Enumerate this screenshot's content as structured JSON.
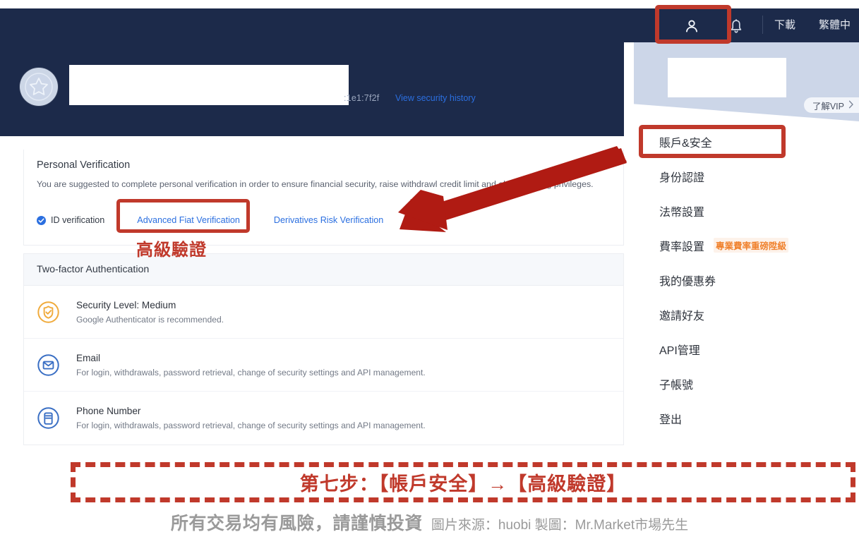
{
  "account_header": {
    "avatar_icon": "star-badge-icon",
    "name_redacted": "",
    "ip_fragment": ":1e1:7f2f",
    "security_history_link": "View security history"
  },
  "personal_verification": {
    "title": "Personal Verification",
    "description": "You are suggested to complete personal verification in order to ensure financial security, raise withdrawl credit limit and obtain trading privileges.",
    "id_verification_label": "ID verification",
    "advanced_fiat_label": "Advanced Fiat Verification",
    "derivatives_risk_label": "Derivatives Risk Verification"
  },
  "two_factor": {
    "header": "Two-factor Authentication",
    "rows": [
      {
        "icon": "shield-check-icon",
        "title": "Security Level: Medium",
        "desc": "Google Authenticator is recommended."
      },
      {
        "icon": "envelope-icon",
        "title": "Email",
        "desc": "For login, withdrawals, password retrieval, change of security settings and API management."
      },
      {
        "icon": "phone-icon",
        "title": "Phone Number",
        "desc": "For login, withdrawals, password retrieval, change of security settings and API management."
      }
    ]
  },
  "right_panel": {
    "topnav": {
      "person_icon": "person-icon",
      "bell_icon": "bell-icon",
      "download_label": "下載",
      "language_label": "繁體中"
    },
    "vip_banner": {
      "learn_vip_label": "了解VIP",
      "chevron_icon": "chevron-right-icon"
    },
    "menu_items": [
      {
        "label": "賬戶&安全",
        "badge": ""
      },
      {
        "label": "身份認證",
        "badge": ""
      },
      {
        "label": "法幣設置",
        "badge": ""
      },
      {
        "label": "費率設置",
        "badge": "專業費率重磅陞級"
      },
      {
        "label": "我的優惠券",
        "badge": ""
      },
      {
        "label": "邀請好友",
        "badge": ""
      },
      {
        "label": "API管理",
        "badge": ""
      },
      {
        "label": "子帳號",
        "badge": ""
      },
      {
        "label": "登出",
        "badge": ""
      }
    ]
  },
  "annotations": {
    "advanced_verification_label": "高級驗證",
    "step_caption": "第七步：【帳戶安全】→【高級驗證】",
    "risk_warning": "所有交易均有風險，請謹慎投資",
    "attribution": "圖片來源：huobi 製圖：Mr.Market市場先生",
    "highlight_color": "#c0392b",
    "arrow_color": "#b01b13"
  },
  "colors": {
    "header_navy": "#1c2a4a",
    "link_blue": "#2b6fe0",
    "badge_orange": "#f0822e",
    "accent_red": "#c0392b"
  }
}
